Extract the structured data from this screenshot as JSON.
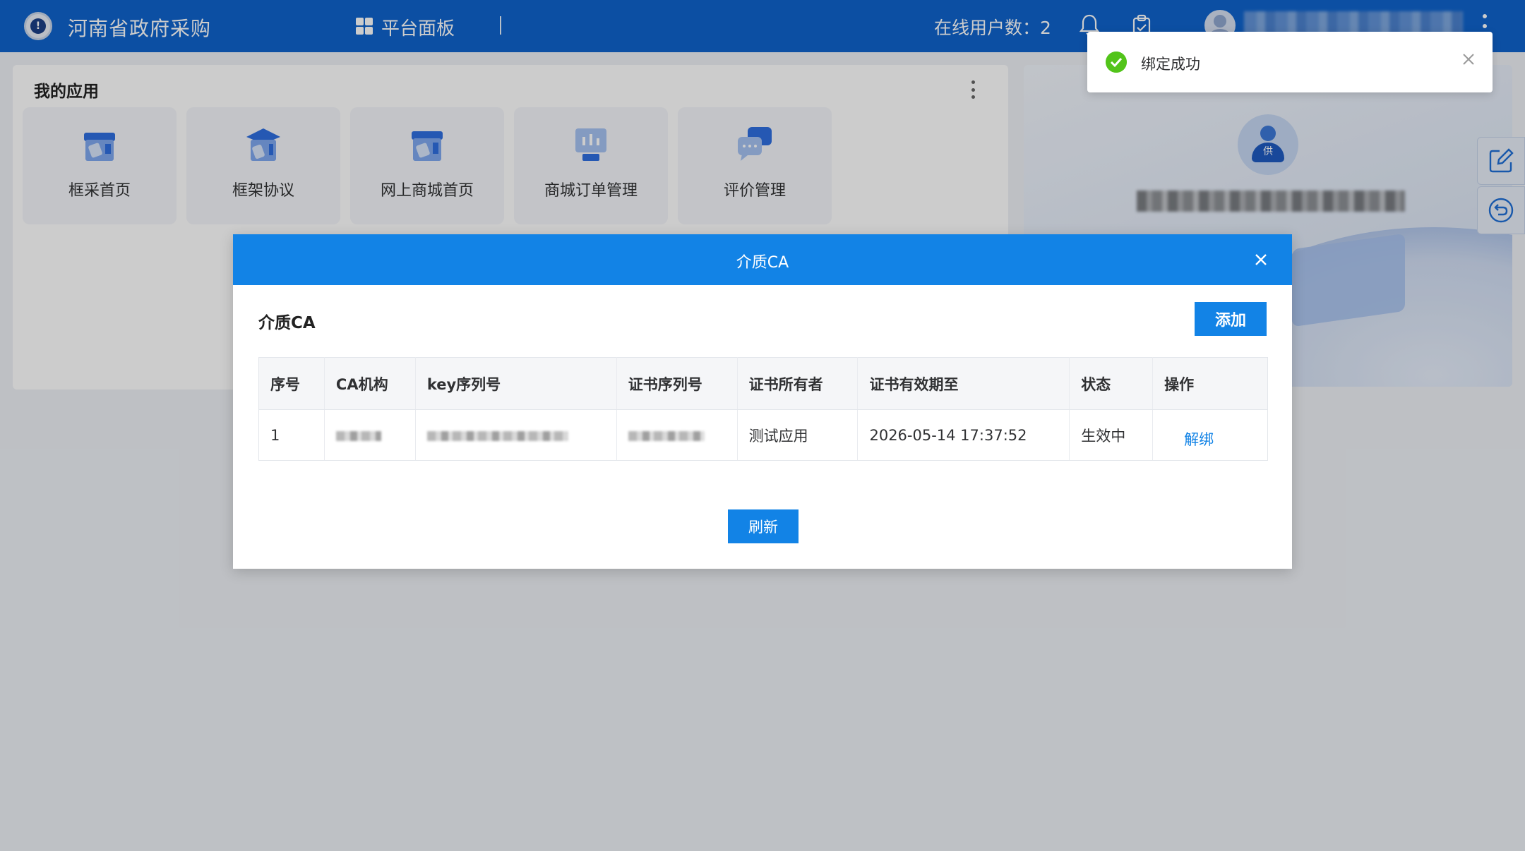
{
  "header": {
    "site_title": "河南省政府采购",
    "dashboard_label": "平台面板",
    "online_users": "在线用户数：2"
  },
  "apps": {
    "title": "我的应用",
    "items": [
      {
        "label": "框采首页",
        "icon": "shop-icon"
      },
      {
        "label": "框架协议",
        "icon": "agreement-icon"
      },
      {
        "label": "网上商城首页",
        "icon": "mall-icon"
      },
      {
        "label": "商城订单管理",
        "icon": "order-icon"
      },
      {
        "label": "评价管理",
        "icon": "comment-icon"
      }
    ]
  },
  "profile": {
    "badge": "供"
  },
  "dialog": {
    "title": "介质CA",
    "section_title": "介质CA",
    "add_label": "添加",
    "refresh_label": "刷新",
    "columns": [
      "序号",
      "CA机构",
      "key序列号",
      "证书序列号",
      "证书所有者",
      "证书有效期至",
      "状态",
      "操作"
    ],
    "rows": [
      {
        "index": "1",
        "owner": "测试应用",
        "valid_until": "2026-05-14 17:37:52",
        "status": "生效中",
        "action": "解绑"
      }
    ]
  },
  "toast": {
    "message": "绑定成功"
  },
  "colors": {
    "header_blue": "#0f63cc",
    "primary": "#1283e6",
    "success": "#52c41a"
  }
}
